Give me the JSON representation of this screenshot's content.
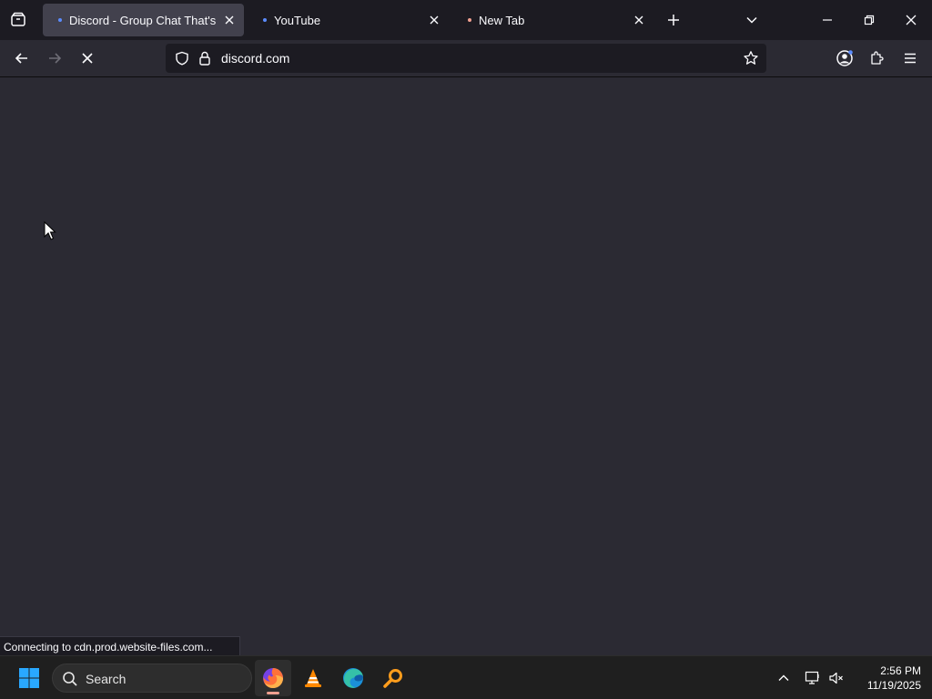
{
  "browser": {
    "tabs": [
      {
        "title": "Discord - Group Chat That's All",
        "active": true,
        "dot_color": "#5b8cff"
      },
      {
        "title": "YouTube",
        "active": false,
        "dot_color": "#5b8cff"
      },
      {
        "title": "New Tab",
        "active": false,
        "dot_color": "#f0a090"
      }
    ],
    "url": "discord.com",
    "status_text": "Connecting to cdn.prod.website-files.com..."
  },
  "taskbar": {
    "search_label": "Search",
    "apps": [
      "firefox-icon",
      "vlc-icon",
      "edge-icon",
      "search-app-icon"
    ],
    "time": "2:56 PM",
    "date": "11/19/2025"
  },
  "colors": {
    "tab_strip": "#1c1b22",
    "toolbar": "#2b2a33",
    "content": "#2b2a33",
    "taskbar": "#1f1f1f"
  }
}
